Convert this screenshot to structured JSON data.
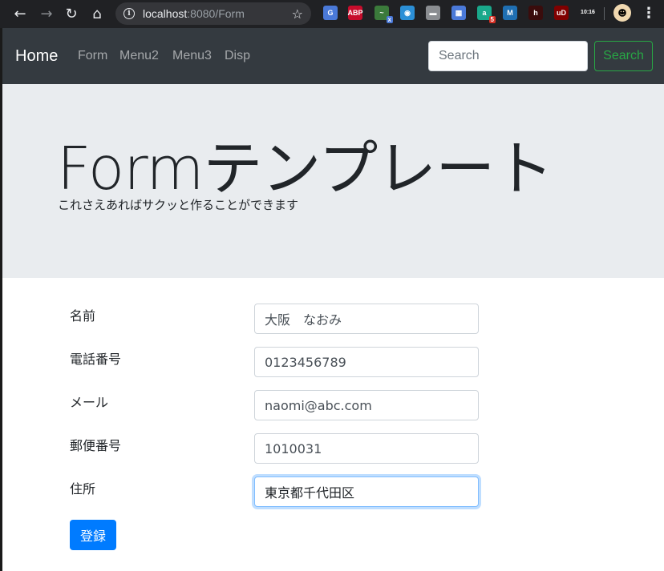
{
  "browser": {
    "url_host": "localhost",
    "url_rest": ":8080/Form",
    "extensions": [
      {
        "name": "translate-ext",
        "label": "G",
        "color": "#4a79d8",
        "badge": ""
      },
      {
        "name": "adblock-ext",
        "label": "ABP",
        "color": "#c70d2c",
        "badge": ""
      },
      {
        "name": "wappalyzer-ext",
        "label": "~",
        "color": "#3b7a3b",
        "badge": "x"
      },
      {
        "name": "camera-ext",
        "label": "◉",
        "color": "#2b8fd6",
        "badge": ""
      },
      {
        "name": "line-ext",
        "label": "▬",
        "color": "#8a8d91",
        "badge": ""
      },
      {
        "name": "pattern-ext",
        "label": "▦",
        "color": "#4a79d8",
        "badge": ""
      },
      {
        "name": "a-ext",
        "label": "a",
        "color": "#1aa88b",
        "badge": "5"
      },
      {
        "name": "m-ext",
        "label": "M",
        "color": "#1f6fb2",
        "badge": ""
      },
      {
        "name": "h-ext",
        "label": "h",
        "color": "#3a0c0c",
        "badge": ""
      },
      {
        "name": "ublock-ext",
        "label": "uD",
        "color": "#800000",
        "badge": ""
      },
      {
        "name": "clock-ext",
        "label": "10:16",
        "color": "#202124",
        "badge": ""
      }
    ]
  },
  "navbar": {
    "brand": "Home",
    "links": [
      "Form",
      "Menu2",
      "Menu3",
      "Disp"
    ],
    "search_placeholder": "Search",
    "search_button": "Search"
  },
  "jumbotron": {
    "title": "Formテンプレート",
    "lead": "これさえあればサクッと作ることができます"
  },
  "form": {
    "fields": [
      {
        "label": "名前",
        "value": "大阪　なおみ"
      },
      {
        "label": "電話番号",
        "value": "0123456789"
      },
      {
        "label": "メール",
        "value": "naomi@abc.com"
      },
      {
        "label": "郵便番号",
        "value": "1010031"
      },
      {
        "label": "住所",
        "value": "東京都千代田区"
      }
    ],
    "submit_label": "登録"
  }
}
